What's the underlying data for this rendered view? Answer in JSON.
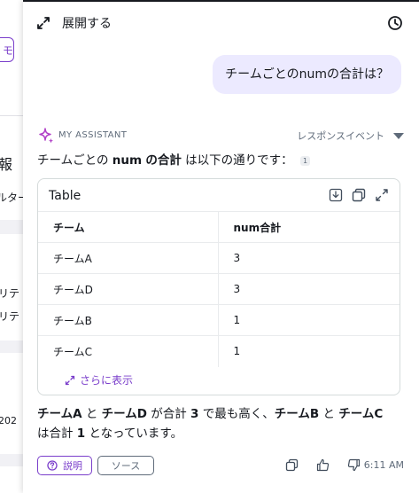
{
  "background": {
    "fragments": [
      "報",
      "ルター",
      "リテ",
      "リテ",
      "202"
    ],
    "pill_char": "モ"
  },
  "header": {
    "expand_label": "展開する"
  },
  "user_message": "チームごとのnumの合計は？",
  "assistant": {
    "name": "MY ASSISTANT",
    "response_event": "レスポンスイベント",
    "intro_prefix": "チームごとの",
    "intro_bold1": "num",
    "intro_mid": "の",
    "intro_bold2": "合計",
    "intro_suffix": "は以下の通りです：",
    "citation": "1"
  },
  "table": {
    "title": "Table",
    "columns": [
      "チーム",
      "num合計"
    ],
    "rows": [
      [
        "チームA",
        "3"
      ],
      [
        "チームD",
        "3"
      ],
      [
        "チームB",
        "1"
      ],
      [
        "チームC",
        "1"
      ]
    ],
    "show_more": "さらに表示"
  },
  "summary": {
    "teamA": "チームA",
    "and1": "と",
    "teamD": "チームD",
    "mid1": "が合計",
    "num3": "3",
    "mid2": "で最も高く、",
    "teamB": "チームB",
    "and2": "と",
    "teamC": "チームC",
    "line2_prefix": "は合計",
    "num1": "1",
    "line2_suffix": "となっています。"
  },
  "footer": {
    "explain_label": "説明",
    "source_label": "ソース",
    "timestamp": "6:11 AM"
  },
  "colors": {
    "accent": "#7a3ecb",
    "bubble": "#eceaff"
  }
}
